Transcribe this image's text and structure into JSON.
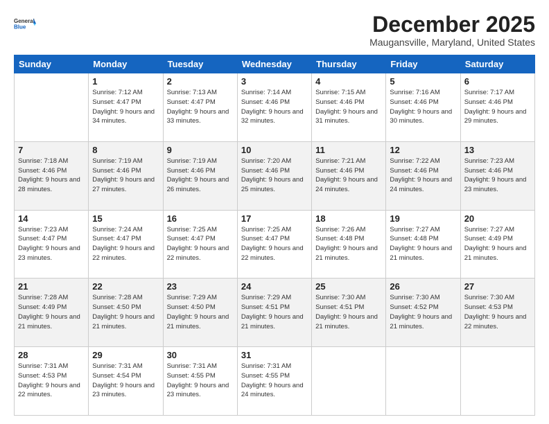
{
  "header": {
    "logo_general": "General",
    "logo_blue": "Blue",
    "month_title": "December 2025",
    "location": "Maugansville, Maryland, United States"
  },
  "days_of_week": [
    "Sunday",
    "Monday",
    "Tuesday",
    "Wednesday",
    "Thursday",
    "Friday",
    "Saturday"
  ],
  "weeks": [
    [
      {
        "day": "",
        "sunrise": "",
        "sunset": "",
        "daylight": ""
      },
      {
        "day": "1",
        "sunrise": "7:12 AM",
        "sunset": "4:47 PM",
        "daylight": "9 hours and 34 minutes."
      },
      {
        "day": "2",
        "sunrise": "7:13 AM",
        "sunset": "4:47 PM",
        "daylight": "9 hours and 33 minutes."
      },
      {
        "day": "3",
        "sunrise": "7:14 AM",
        "sunset": "4:46 PM",
        "daylight": "9 hours and 32 minutes."
      },
      {
        "day": "4",
        "sunrise": "7:15 AM",
        "sunset": "4:46 PM",
        "daylight": "9 hours and 31 minutes."
      },
      {
        "day": "5",
        "sunrise": "7:16 AM",
        "sunset": "4:46 PM",
        "daylight": "9 hours and 30 minutes."
      },
      {
        "day": "6",
        "sunrise": "7:17 AM",
        "sunset": "4:46 PM",
        "daylight": "9 hours and 29 minutes."
      }
    ],
    [
      {
        "day": "7",
        "sunrise": "7:18 AM",
        "sunset": "4:46 PM",
        "daylight": "9 hours and 28 minutes."
      },
      {
        "day": "8",
        "sunrise": "7:19 AM",
        "sunset": "4:46 PM",
        "daylight": "9 hours and 27 minutes."
      },
      {
        "day": "9",
        "sunrise": "7:19 AM",
        "sunset": "4:46 PM",
        "daylight": "9 hours and 26 minutes."
      },
      {
        "day": "10",
        "sunrise": "7:20 AM",
        "sunset": "4:46 PM",
        "daylight": "9 hours and 25 minutes."
      },
      {
        "day": "11",
        "sunrise": "7:21 AM",
        "sunset": "4:46 PM",
        "daylight": "9 hours and 24 minutes."
      },
      {
        "day": "12",
        "sunrise": "7:22 AM",
        "sunset": "4:46 PM",
        "daylight": "9 hours and 24 minutes."
      },
      {
        "day": "13",
        "sunrise": "7:23 AM",
        "sunset": "4:46 PM",
        "daylight": "9 hours and 23 minutes."
      }
    ],
    [
      {
        "day": "14",
        "sunrise": "7:23 AM",
        "sunset": "4:47 PM",
        "daylight": "9 hours and 23 minutes."
      },
      {
        "day": "15",
        "sunrise": "7:24 AM",
        "sunset": "4:47 PM",
        "daylight": "9 hours and 22 minutes."
      },
      {
        "day": "16",
        "sunrise": "7:25 AM",
        "sunset": "4:47 PM",
        "daylight": "9 hours and 22 minutes."
      },
      {
        "day": "17",
        "sunrise": "7:25 AM",
        "sunset": "4:47 PM",
        "daylight": "9 hours and 22 minutes."
      },
      {
        "day": "18",
        "sunrise": "7:26 AM",
        "sunset": "4:48 PM",
        "daylight": "9 hours and 21 minutes."
      },
      {
        "day": "19",
        "sunrise": "7:27 AM",
        "sunset": "4:48 PM",
        "daylight": "9 hours and 21 minutes."
      },
      {
        "day": "20",
        "sunrise": "7:27 AM",
        "sunset": "4:49 PM",
        "daylight": "9 hours and 21 minutes."
      }
    ],
    [
      {
        "day": "21",
        "sunrise": "7:28 AM",
        "sunset": "4:49 PM",
        "daylight": "9 hours and 21 minutes."
      },
      {
        "day": "22",
        "sunrise": "7:28 AM",
        "sunset": "4:50 PM",
        "daylight": "9 hours and 21 minutes."
      },
      {
        "day": "23",
        "sunrise": "7:29 AM",
        "sunset": "4:50 PM",
        "daylight": "9 hours and 21 minutes."
      },
      {
        "day": "24",
        "sunrise": "7:29 AM",
        "sunset": "4:51 PM",
        "daylight": "9 hours and 21 minutes."
      },
      {
        "day": "25",
        "sunrise": "7:30 AM",
        "sunset": "4:51 PM",
        "daylight": "9 hours and 21 minutes."
      },
      {
        "day": "26",
        "sunrise": "7:30 AM",
        "sunset": "4:52 PM",
        "daylight": "9 hours and 21 minutes."
      },
      {
        "day": "27",
        "sunrise": "7:30 AM",
        "sunset": "4:53 PM",
        "daylight": "9 hours and 22 minutes."
      }
    ],
    [
      {
        "day": "28",
        "sunrise": "7:31 AM",
        "sunset": "4:53 PM",
        "daylight": "9 hours and 22 minutes."
      },
      {
        "day": "29",
        "sunrise": "7:31 AM",
        "sunset": "4:54 PM",
        "daylight": "9 hours and 23 minutes."
      },
      {
        "day": "30",
        "sunrise": "7:31 AM",
        "sunset": "4:55 PM",
        "daylight": "9 hours and 23 minutes."
      },
      {
        "day": "31",
        "sunrise": "7:31 AM",
        "sunset": "4:55 PM",
        "daylight": "9 hours and 24 minutes."
      },
      {
        "day": "",
        "sunrise": "",
        "sunset": "",
        "daylight": ""
      },
      {
        "day": "",
        "sunrise": "",
        "sunset": "",
        "daylight": ""
      },
      {
        "day": "",
        "sunrise": "",
        "sunset": "",
        "daylight": ""
      }
    ]
  ]
}
